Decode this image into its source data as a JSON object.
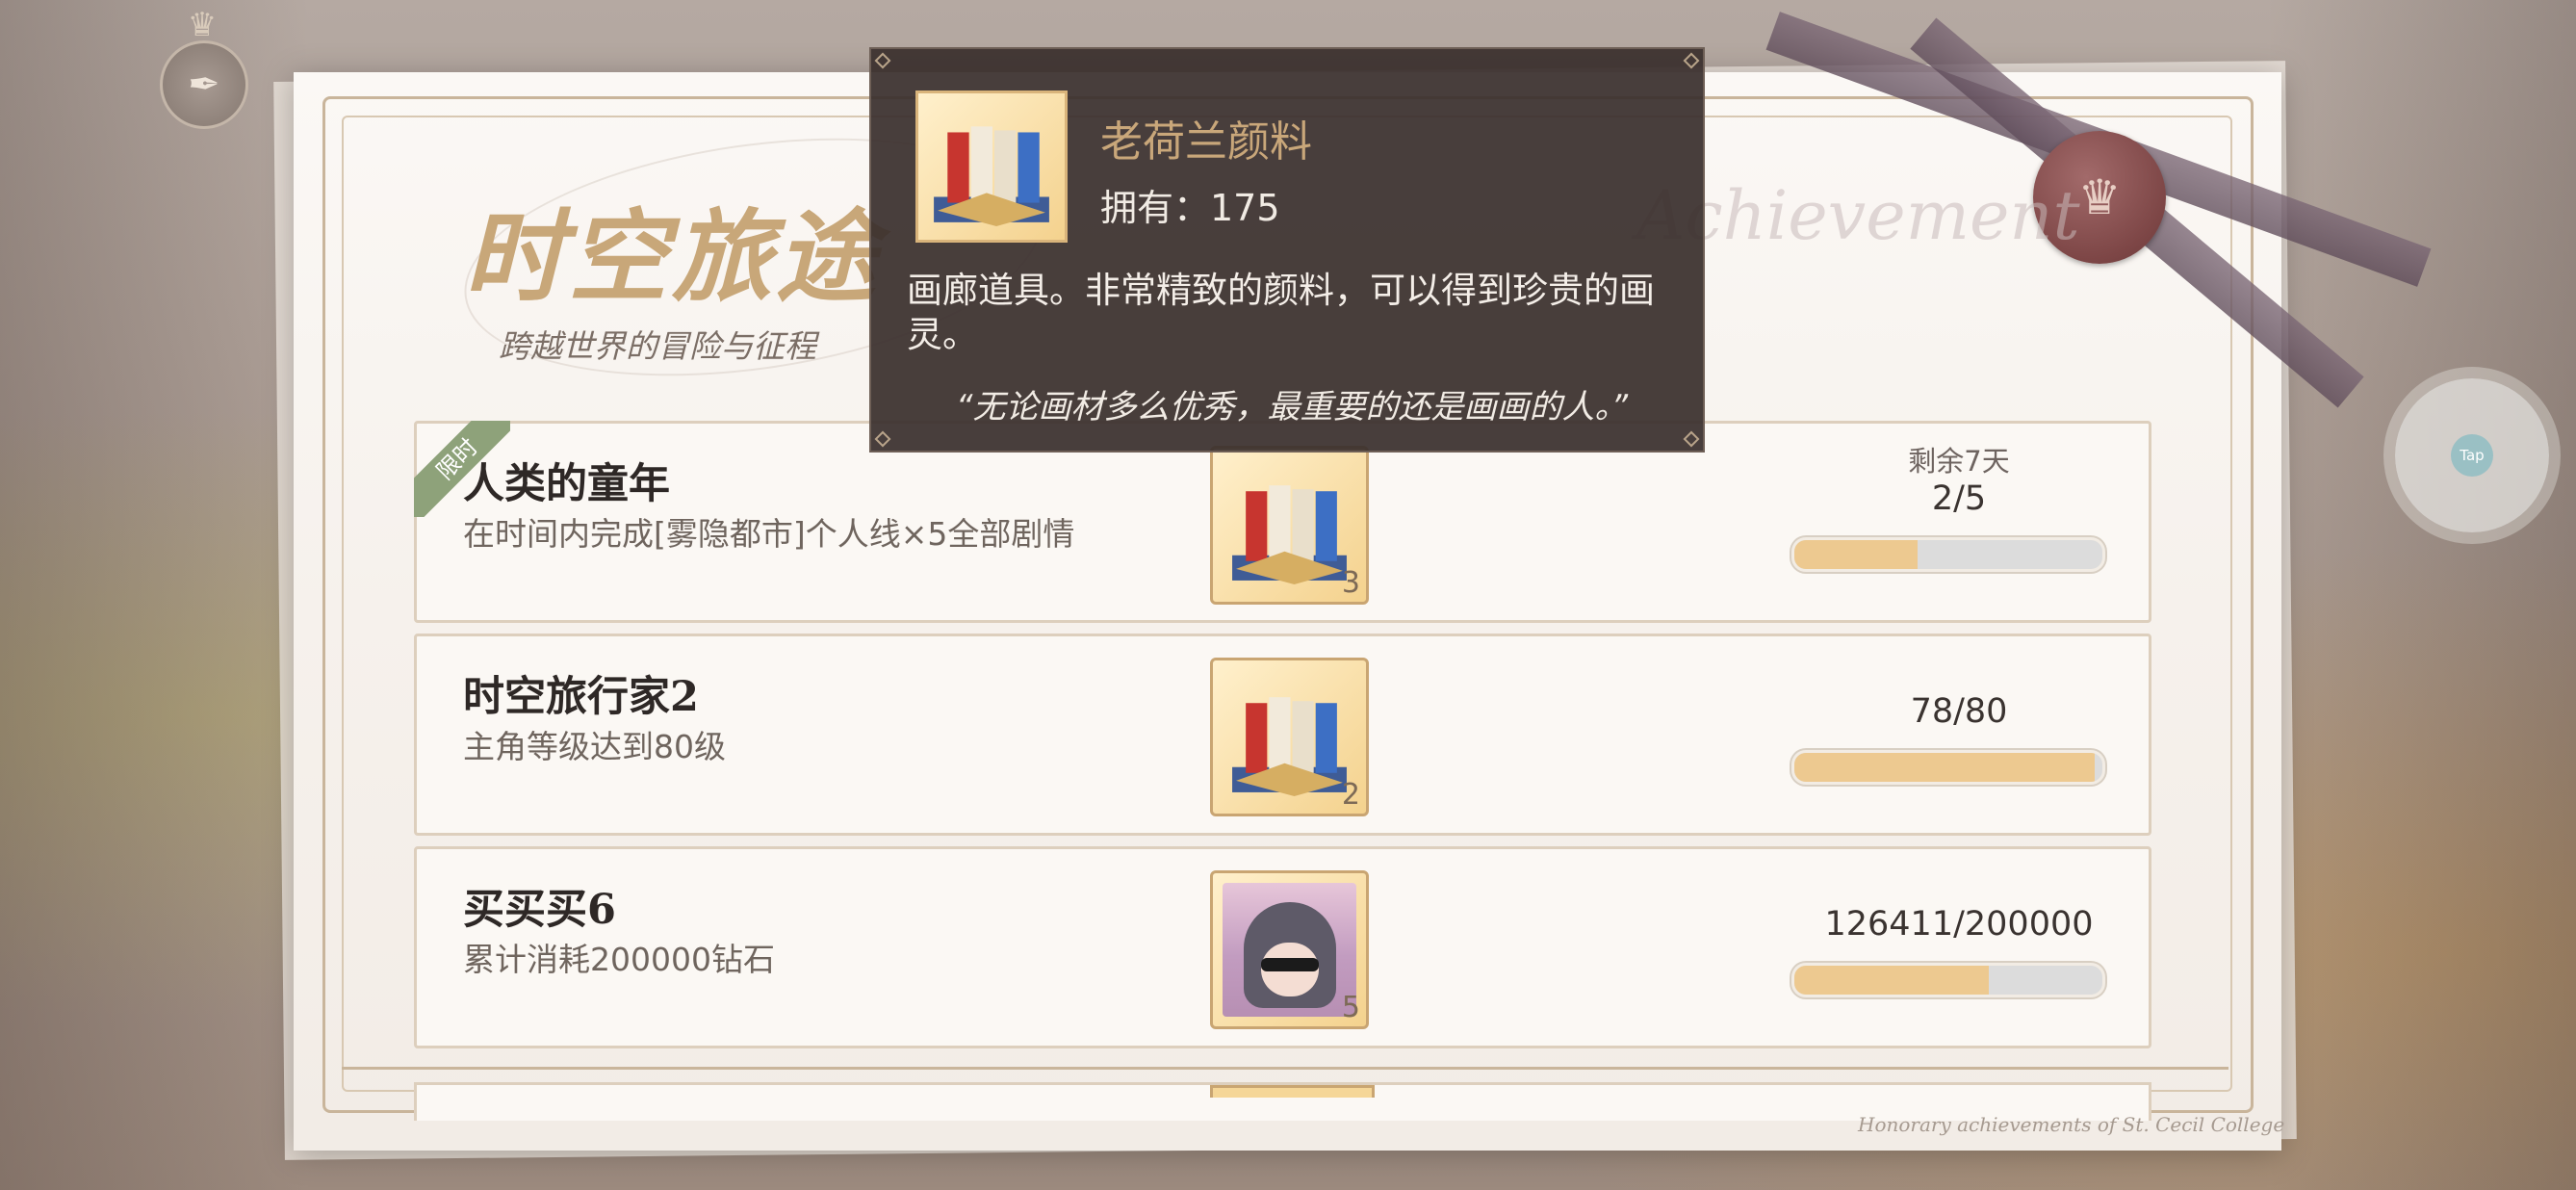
{
  "header": {
    "title": "时空旅途",
    "subtitle": "跨越世界的冒险与征程",
    "watermark": "Achievement",
    "footer_watermark": "Honorary achievements of St. Cecil College"
  },
  "tooltip": {
    "item_name": "老荷兰颜料",
    "own_text": "拥有：175",
    "description": "画廊道具。非常精致的颜料，可以得到珍贵的画灵。",
    "quote": "“无论画材多么优秀，最重要的还是画画的人。”",
    "icon": "paint-set-icon"
  },
  "achievements": [
    {
      "name": "人类的童年",
      "description": "在时间内完成[雾隐都市]个人线×5全部剧情",
      "tag": "限时",
      "remaining": "剩余7天",
      "progress_text": "2/5",
      "progress": 0.4,
      "reward_icon": "paint-set-icon",
      "reward_count": "3"
    },
    {
      "name": "时空旅行家2",
      "description": "主角等级达到80级",
      "progress_text": "78/80",
      "progress": 0.975,
      "reward_icon": "paint-set-icon",
      "reward_count": "2"
    },
    {
      "name": "买买买6",
      "description": "累计消耗200000钻石",
      "progress_text": "126411/200000",
      "progress": 0.632,
      "reward_icon": "character-portrait-icon",
      "reward_count": "5"
    }
  ],
  "tap_button": {
    "label": "Tap"
  },
  "colors": {
    "accent_gold": "#c9a77a",
    "progress_fill": "#edc990",
    "tooltip_bg": "#3a2f2d",
    "limited_tag": "#8ea27a",
    "seal": "#7d4646"
  }
}
